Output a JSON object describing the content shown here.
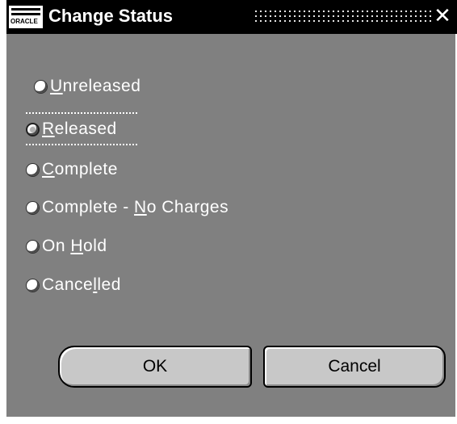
{
  "window": {
    "title": "Change Status",
    "close_glyph": "✕",
    "icon": "oracle-app-icon",
    "icon_text": "ORACLE"
  },
  "status_options": [
    {
      "label_prefix": "",
      "label_mnemonic": "U",
      "label_rest": "nreleased",
      "selected": false,
      "focused": false
    },
    {
      "label_prefix": "",
      "label_mnemonic": "R",
      "label_rest": "eleased",
      "selected": true,
      "focused": true
    },
    {
      "label_prefix": "",
      "label_mnemonic": "C",
      "label_rest": "omplete",
      "selected": false,
      "focused": false
    },
    {
      "label_prefix": "Complete - ",
      "label_mnemonic": "N",
      "label_rest": "o Charges",
      "selected": false,
      "focused": false
    },
    {
      "label_prefix": "On ",
      "label_mnemonic": "H",
      "label_rest": "old",
      "selected": false,
      "focused": false
    },
    {
      "label_prefix": "Cance",
      "label_mnemonic": "l",
      "label_rest": "led",
      "selected": false,
      "focused": false
    }
  ],
  "buttons": {
    "ok_label": "OK",
    "cancel_label": "Cancel"
  },
  "colors": {
    "titlebar": "#000000",
    "client_background": "#808080",
    "button_face": "#c8c8c8",
    "label_text": "#ffffff"
  }
}
